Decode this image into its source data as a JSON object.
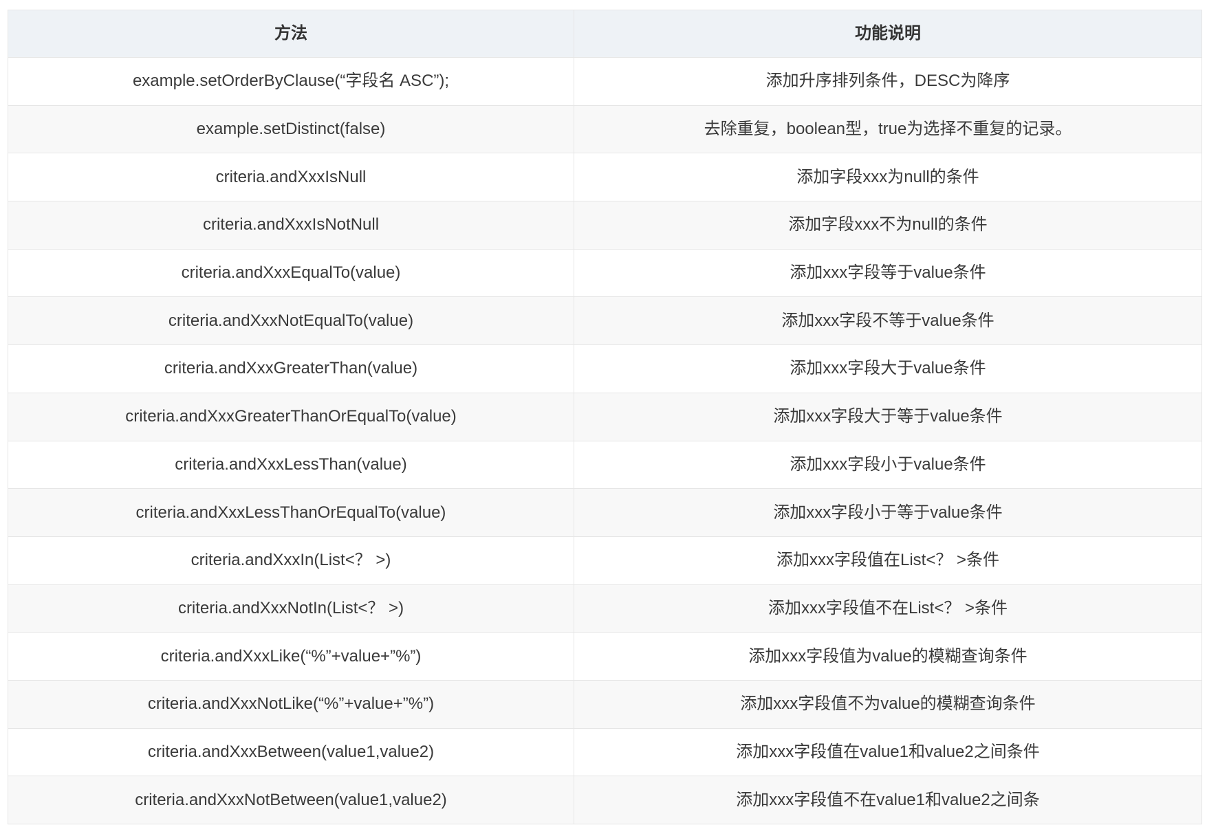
{
  "table": {
    "headers": [
      "方法",
      "功能说明"
    ],
    "rows": [
      [
        "example.setOrderByClause(“字段名 ASC”);",
        "添加升序排列条件，DESC为降序"
      ],
      [
        "example.setDistinct(false)",
        "去除重复，boolean型，true为选择不重复的记录。"
      ],
      [
        "criteria.andXxxIsNull",
        "添加字段xxx为null的条件"
      ],
      [
        "criteria.andXxxIsNotNull",
        "添加字段xxx不为null的条件"
      ],
      [
        "criteria.andXxxEqualTo(value)",
        "添加xxx字段等于value条件"
      ],
      [
        "criteria.andXxxNotEqualTo(value)",
        "添加xxx字段不等于value条件"
      ],
      [
        "criteria.andXxxGreaterThan(value)",
        "添加xxx字段大于value条件"
      ],
      [
        "criteria.andXxxGreaterThanOrEqualTo(value)",
        "添加xxx字段大于等于value条件"
      ],
      [
        "criteria.andXxxLessThan(value)",
        "添加xxx字段小于value条件"
      ],
      [
        "criteria.andXxxLessThanOrEqualTo(value)",
        "添加xxx字段小于等于value条件"
      ],
      [
        "criteria.andXxxIn(List<？ >)",
        "添加xxx字段值在List<？ >条件"
      ],
      [
        "criteria.andXxxNotIn(List<？ >)",
        "添加xxx字段值不在List<？ >条件"
      ],
      [
        "criteria.andXxxLike(“%”+value+”%”)",
        "添加xxx字段值为value的模糊查询条件"
      ],
      [
        "criteria.andXxxNotLike(“%”+value+”%”)",
        "添加xxx字段值不为value的模糊查询条件"
      ],
      [
        "criteria.andXxxBetween(value1,value2)",
        "添加xxx字段值在value1和value2之间条件"
      ],
      [
        "criteria.andXxxNotBetween(value1,value2)",
        "添加xxx字段值不在value1和value2之间条"
      ]
    ]
  }
}
